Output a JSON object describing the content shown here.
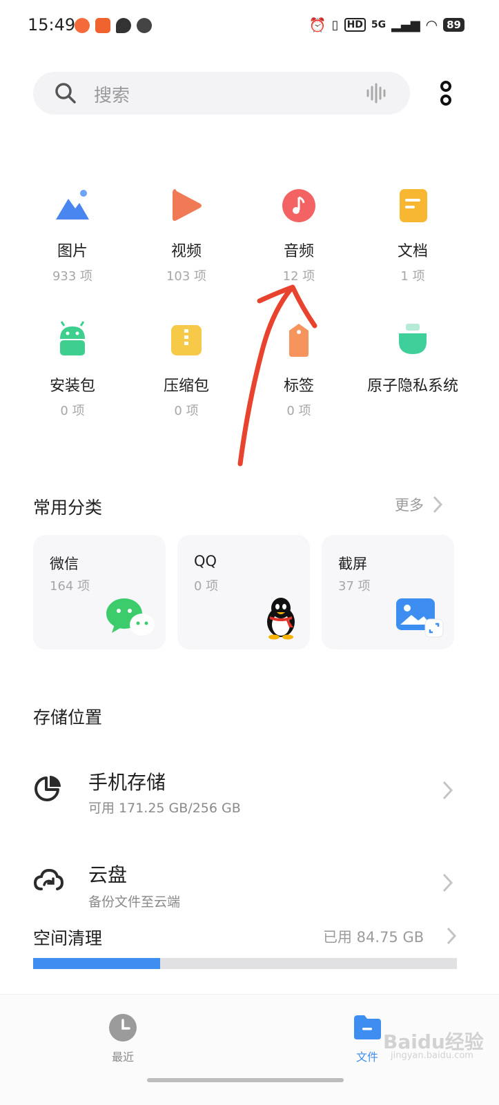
{
  "status_bar": {
    "time": "15:49",
    "network": "5G",
    "hd": "HD",
    "battery": "89"
  },
  "search": {
    "placeholder": "搜索"
  },
  "categories": [
    {
      "label": "图片",
      "count": "933 项",
      "icon": "image-icon",
      "color": "#4a86f0"
    },
    {
      "label": "视频",
      "count": "103 项",
      "icon": "video-icon",
      "color": "#f06a4a"
    },
    {
      "label": "音频",
      "count": "12 项",
      "icon": "audio-icon",
      "color": "#f25a5a"
    },
    {
      "label": "文档",
      "count": "1 项",
      "icon": "document-icon",
      "color": "#f7b731"
    },
    {
      "label": "安装包",
      "count": "0 项",
      "icon": "android-icon",
      "color": "#3ecf8e"
    },
    {
      "label": "压缩包",
      "count": "0 项",
      "icon": "archive-icon",
      "color": "#f7c948"
    },
    {
      "label": "标签",
      "count": "0 项",
      "icon": "tag-icon",
      "color": "#f5945c"
    },
    {
      "label": "原子隐私系统",
      "count": "",
      "icon": "privacy-icon",
      "color": "#3ecf9a"
    }
  ],
  "common": {
    "title": "常用分类",
    "more": "更多",
    "cards": [
      {
        "title": "微信",
        "count": "164 项",
        "icon": "wechat-icon"
      },
      {
        "title": "QQ",
        "count": "0 项",
        "icon": "qq-penguin-icon"
      },
      {
        "title": "截屏",
        "count": "37 项",
        "icon": "screenshot-icon"
      }
    ]
  },
  "storage": {
    "title": "存储位置",
    "phone": {
      "title": "手机存储",
      "sub": "可用 171.25 GB/256 GB"
    },
    "cloud": {
      "title": "云盘",
      "sub": "备份文件至云端"
    }
  },
  "cleanup": {
    "title": "空间清理",
    "used": "已用 84.75 GB",
    "progress_fraction": 0.3
  },
  "nav": {
    "recent": "最近",
    "files": "文件"
  },
  "watermark": {
    "text": "Baidu经验",
    "sub": "jingyan.baidu.com"
  },
  "colors": {
    "accent": "#3d8ef0",
    "annotation": "#e8432f"
  }
}
